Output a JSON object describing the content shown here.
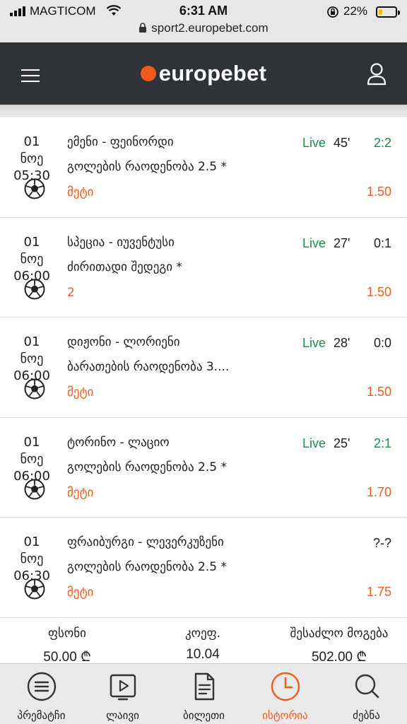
{
  "status_bar": {
    "carrier": "MAGTICOM",
    "time": "6:31 AM",
    "battery": "22%",
    "url": "sport2.europebet.com"
  },
  "header": {
    "logo": "europebet"
  },
  "colors": {
    "brand_orange": "#f05a1d",
    "live_green": "#1b8b49",
    "header_bg": "#2f3236"
  },
  "bets": [
    {
      "date": "01 ნოე",
      "time": "05:30",
      "match": "ემენი - ფეინორდი",
      "market": "გოლების რაოდენობა 2.5 *",
      "pick": "მეტი",
      "live": "Live",
      "minute": "45'",
      "score": "2:2",
      "score_color": "#1b8b49",
      "odds": "1.50"
    },
    {
      "date": "01 ნოე",
      "time": "06:00",
      "match": "სპეცია - იუვენტუსი",
      "market": "ძირითადი შედეგი *",
      "pick": "2",
      "live": "Live",
      "minute": "27'",
      "score": "0:1",
      "score_color": "#1d1d1d",
      "odds": "1.50"
    },
    {
      "date": "01 ნოე",
      "time": "06:00",
      "match": "დიჟონი - ლორიენი",
      "market": "ბარათების რაოდენობა 3....",
      "pick": "მეტი",
      "live": "Live",
      "minute": "28'",
      "score": "0:0",
      "score_color": "#1d1d1d",
      "odds": "1.50"
    },
    {
      "date": "01 ნოე",
      "time": "06:00",
      "match": "ტორინო - ლაციო",
      "market": "გოლების რაოდენობა 2.5 *",
      "pick": "მეტი",
      "live": "Live",
      "minute": "25'",
      "score": "2:1",
      "score_color": "#1b8b49",
      "odds": "1.70"
    },
    {
      "date": "01 ნოე",
      "time": "06:30",
      "match": "ფრაიბურგი - ლევერკუზენი",
      "market": "გოლების რაოდენობა 2.5 *",
      "pick": "მეტი",
      "live": "",
      "minute": "",
      "score": "?-?",
      "score_color": "#1d1d1d",
      "odds": "1.75"
    }
  ],
  "summary": {
    "stake_label": "ფსონი",
    "stake_value": "50.00 ₾",
    "odds_label": "კოეფ.",
    "odds_value": "10.04",
    "win_label": "შესაძლო მოგება",
    "win_value": "502.00 ₾"
  },
  "bottom_nav": [
    {
      "label": "პრემატჩი",
      "icon": "list-icon"
    },
    {
      "label": "ლაივი",
      "icon": "play-icon"
    },
    {
      "label": "ბილეთი",
      "icon": "ticket-icon"
    },
    {
      "label": "ისტორია",
      "icon": "clock-icon",
      "active": true
    },
    {
      "label": "ძებნა",
      "icon": "search-icon"
    }
  ]
}
